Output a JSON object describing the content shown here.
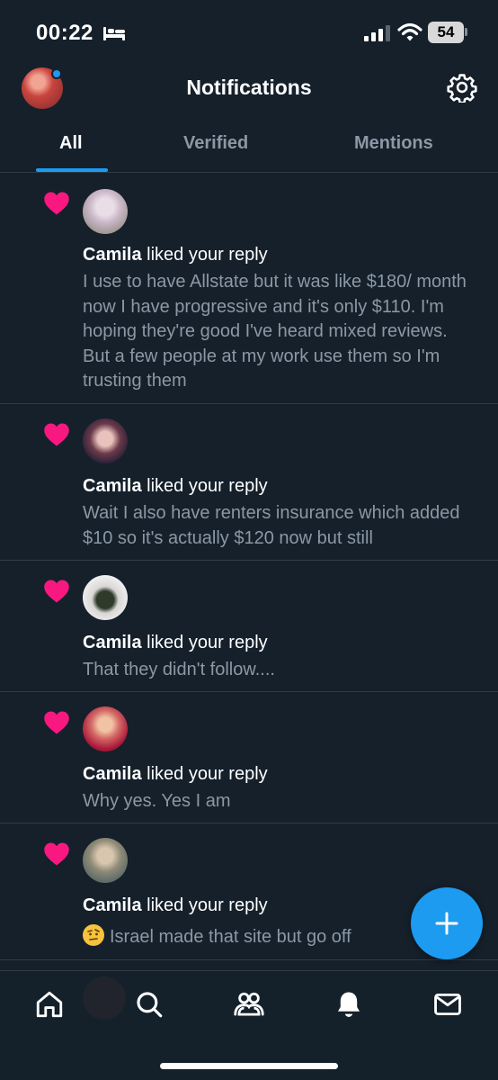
{
  "status_bar": {
    "time": "00:22",
    "battery": "54",
    "icons": [
      "bed-icon",
      "signal-icon",
      "wifi-icon",
      "battery-icon"
    ]
  },
  "header": {
    "title": "Notifications",
    "icons": [
      "avatar",
      "settings-gear-icon"
    ]
  },
  "tabs": [
    {
      "label": "All",
      "active": true
    },
    {
      "label": "Verified",
      "active": false
    },
    {
      "label": "Mentions",
      "active": false
    }
  ],
  "notifications": [
    {
      "name": "Camila",
      "action": "liked your reply",
      "text": "I use to have Allstate but it was like $180/ month now I have progressive and it's only $110. I'm hoping they're good I've heard mixed reviews. But a few people at my work use them so I'm trusting them"
    },
    {
      "name": "Camila",
      "action": "liked your reply",
      "text": "Wait I also have renters insurance which added $10 so it's actually $120 now but still"
    },
    {
      "name": "Camila",
      "action": "liked your reply",
      "text": "That they didn't follow...."
    },
    {
      "name": "Camila",
      "action": "liked your reply",
      "text": "Why yes. Yes I am"
    },
    {
      "name": "Camila",
      "action": "liked your reply",
      "text": "Israel made that site but go off",
      "emoji": "face-with-raised-eyebrow"
    }
  ],
  "fab": {
    "icon": "plus-icon"
  },
  "bottom_nav": {
    "items": [
      "home-icon",
      "search-icon",
      "communities-icon",
      "notifications-bell-icon",
      "messages-icon"
    ]
  },
  "colors": {
    "background": "#15202b",
    "accent": "#1d9bf0",
    "heart": "#f91880",
    "secondary_text": "#8b98a5",
    "divider": "#2f3b47"
  }
}
